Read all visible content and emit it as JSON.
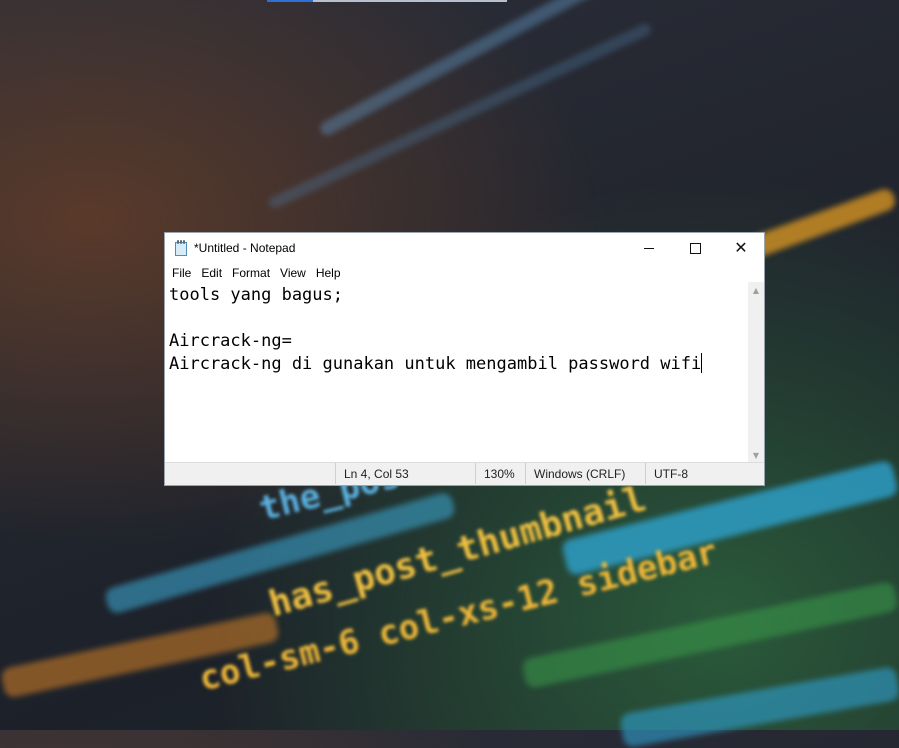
{
  "window": {
    "title": "*Untitled - Notepad"
  },
  "menu": {
    "items": [
      "File",
      "Edit",
      "Format",
      "View",
      "Help"
    ]
  },
  "editor": {
    "lines": [
      "tools yang bagus;",
      "",
      "Aircrack-ng=",
      "Aircrack-ng di gunakan untuk mengambil password wifi"
    ]
  },
  "status": {
    "position": "Ln 4, Col 53",
    "zoom": "130%",
    "line_ending": "Windows (CRLF)",
    "encoding": "UTF-8"
  },
  "background": {
    "code_text": [
      "the_post()?>",
      "has_post_thumbnail",
      "col-sm-6 col-xs-12 sidebar"
    ]
  },
  "icons": {
    "app": "notepad-icon",
    "minimize": "minimize-icon",
    "maximize": "maximize-icon",
    "close": "close-icon",
    "scroll_up": "scroll-up-icon",
    "scroll_down": "scroll-down-icon"
  }
}
